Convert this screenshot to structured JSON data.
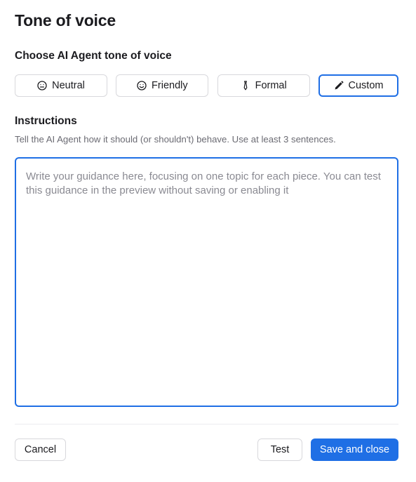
{
  "title": "Tone of voice",
  "tone_section": {
    "heading": "Choose AI Agent tone of voice",
    "options": [
      {
        "label": "Neutral",
        "icon": "neutral-face-icon",
        "selected": false
      },
      {
        "label": "Friendly",
        "icon": "smile-face-icon",
        "selected": false
      },
      {
        "label": "Formal",
        "icon": "tie-icon",
        "selected": false
      },
      {
        "label": "Custom",
        "icon": "pencil-icon",
        "selected": true
      }
    ]
  },
  "instructions": {
    "heading": "Instructions",
    "help_text": "Tell the AI Agent how it should (or shouldn't) behave. Use at least 3 sentences.",
    "value": "",
    "placeholder": "Write your guidance here, focusing on one topic for each piece. You can test this guidance in the preview without saving or enabling it"
  },
  "footer": {
    "cancel_label": "Cancel",
    "test_label": "Test",
    "save_label": "Save and close"
  },
  "colors": {
    "accent": "#1f6fe5",
    "border": "#d8d8dc",
    "muted_text": "#6b6b73"
  }
}
